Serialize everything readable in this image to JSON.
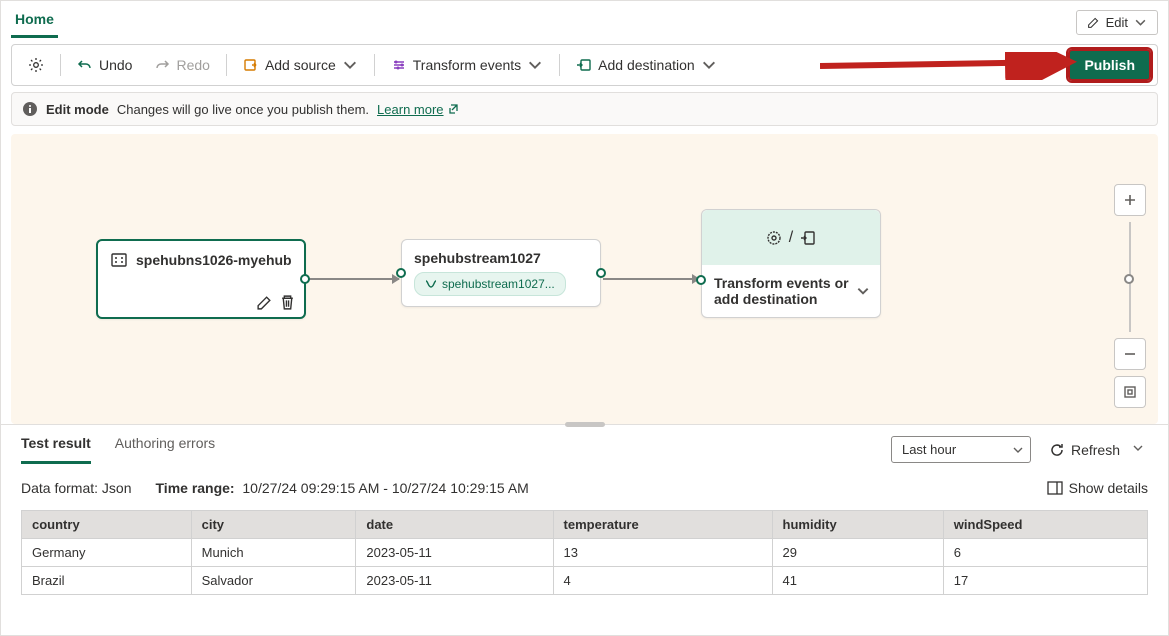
{
  "tabs": {
    "home": "Home",
    "edit": "Edit"
  },
  "toolbar": {
    "undo": "Undo",
    "redo": "Redo",
    "add_source": "Add source",
    "transform": "Transform events",
    "add_dest": "Add destination",
    "publish": "Publish"
  },
  "info": {
    "mode": "Edit mode",
    "msg": "Changes will go live once you publish them.",
    "learn": "Learn more"
  },
  "nodes": {
    "source_title": "spehubns1026-myehub",
    "stream_title": "spehubstream1027",
    "stream_chip": "spehubstream1027...",
    "dest_body": "Transform events or add destination"
  },
  "results": {
    "tab_test": "Test result",
    "tab_errors": "Authoring errors",
    "timerange_select": "Last hour",
    "refresh": "Refresh",
    "df_label": "Data format:",
    "df_value": "Json",
    "tr_label": "Time range:",
    "tr_value": "10/27/24 09:29:15 AM - 10/27/24 10:29:15 AM",
    "show_details": "Show details",
    "columns": [
      "country",
      "city",
      "date",
      "temperature",
      "humidity",
      "windSpeed"
    ],
    "rows": [
      {
        "country": "Germany",
        "city": "Munich",
        "date": "2023-05-11",
        "temperature": "13",
        "humidity": "29",
        "windSpeed": "6"
      },
      {
        "country": "Brazil",
        "city": "Salvador",
        "date": "2023-05-11",
        "temperature": "4",
        "humidity": "41",
        "windSpeed": "17"
      }
    ]
  }
}
